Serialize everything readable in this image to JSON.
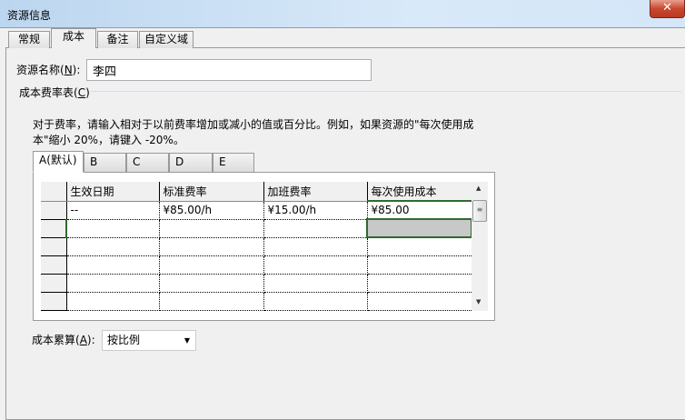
{
  "window": {
    "title": "资源信息",
    "close": "✕"
  },
  "tabs": [
    "常规",
    "成本",
    "备注",
    "自定义域"
  ],
  "resource_name": {
    "label_pre": "资源名称(",
    "label_key": "N",
    "label_post": "):",
    "value": "李四"
  },
  "cost_table": {
    "label_pre": "成本费率表(",
    "label_key": "C",
    "label_post": ")",
    "instructions_line1": "对于费率，请输入相对于以前费率增加或减小的值或百分比。例如，如果资源的\"每次使用成",
    "instructions_line2": "本\"缩小 20%，请键入 -20%。",
    "tabs": [
      "A(默认)",
      "B",
      "C",
      "D",
      "E"
    ],
    "columns": [
      "生效日期",
      "标准费率",
      "加班费率",
      "每次使用成本"
    ],
    "rows": [
      [
        "--",
        "¥85.00/h",
        "¥15.00/h",
        "¥85.00"
      ],
      [
        "",
        "",
        "",
        ""
      ],
      [
        "",
        "",
        "",
        ""
      ],
      [
        "",
        "",
        "",
        ""
      ],
      [
        "",
        "",
        "",
        ""
      ],
      [
        "",
        "",
        "",
        ""
      ]
    ]
  },
  "accrual": {
    "label_pre": "成本累算(",
    "label_key": "A",
    "label_post": "):",
    "value": "按比例"
  }
}
